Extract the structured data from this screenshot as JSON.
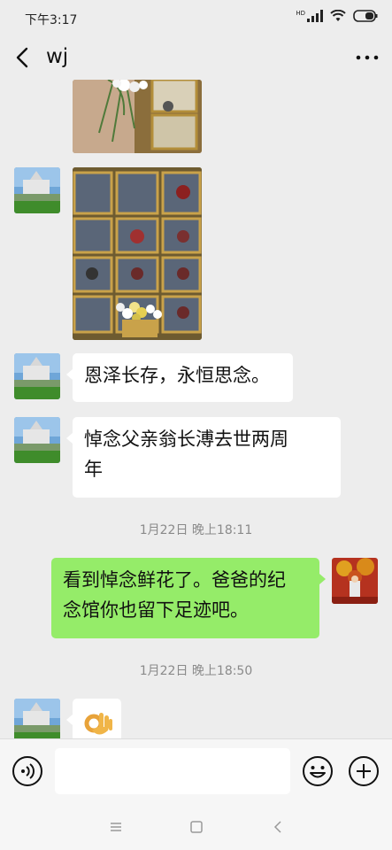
{
  "status_bar": {
    "time": "下午3:17",
    "signal_label": "HD"
  },
  "header": {
    "title": "wj"
  },
  "messages": [
    {
      "side": "left",
      "type": "image",
      "content": "memorial-wall-photo-partial"
    },
    {
      "side": "left",
      "type": "image",
      "content": "memorial-wall-with-flowers-photo"
    },
    {
      "side": "left",
      "type": "text",
      "text": "恩泽长存，永恒思念。"
    },
    {
      "side": "left",
      "type": "text",
      "text_line1": "悼念父亲翁长溥去世两周",
      "text_line2": "年"
    },
    {
      "side": "right",
      "type": "text",
      "text_line1": "看到悼念鲜花了。爸爸的纪",
      "text_line2": "念馆你也留下足迹吧。"
    },
    {
      "side": "left",
      "type": "emoji",
      "content": "ok-hand-emoji"
    }
  ],
  "timestamps": [
    "1月22日 晚上18:11",
    "1月22日 晚上18:50"
  ],
  "input_bar": {
    "placeholder": ""
  },
  "colors": {
    "background": "#ededed",
    "bubble_left": "#ffffff",
    "bubble_right": "#95ec69",
    "timestamp_text": "#8a8a8a"
  }
}
